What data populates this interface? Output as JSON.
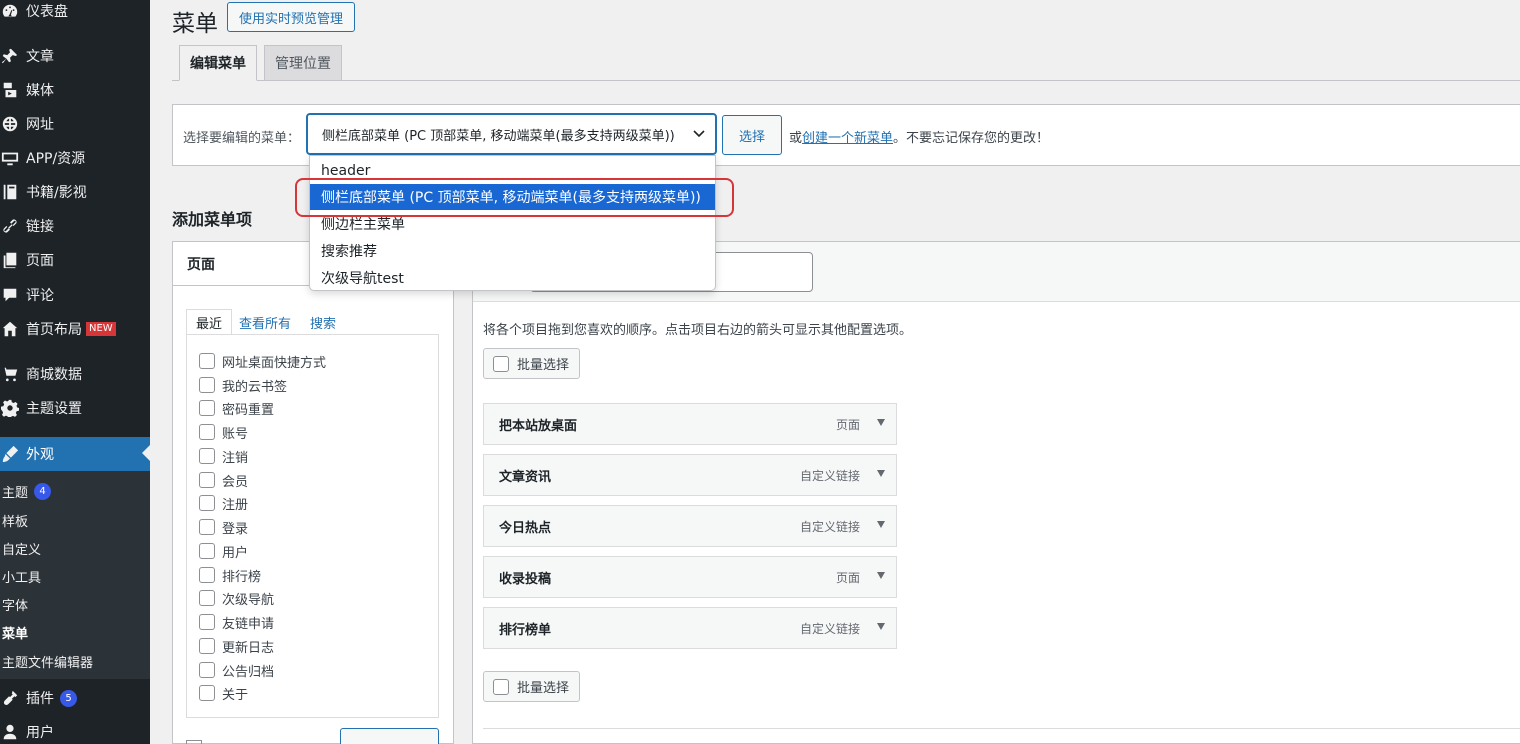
{
  "sidebar": {
    "items": [
      {
        "label": "仪表盘",
        "icon": "dashboard-icon"
      },
      {
        "label": "文章",
        "icon": "pin-icon"
      },
      {
        "label": "媒体",
        "icon": "media-icon"
      },
      {
        "label": "网址",
        "icon": "globe-icon"
      },
      {
        "label": "APP/资源",
        "icon": "monitor-icon"
      },
      {
        "label": "书籍/影视",
        "icon": "book-icon"
      },
      {
        "label": "链接",
        "icon": "link-icon"
      },
      {
        "label": "页面",
        "icon": "page-icon"
      },
      {
        "label": "评论",
        "icon": "comment-icon"
      },
      {
        "label": "首页布局",
        "icon": "home-icon",
        "badge": "NEW"
      },
      {
        "label": "商城数据",
        "icon": "cart-icon"
      },
      {
        "label": "主题设置",
        "icon": "gear-icon"
      },
      {
        "label": "外观",
        "icon": "brush-icon",
        "active": true
      },
      {
        "label": "插件",
        "icon": "plugin-icon",
        "count": "5"
      },
      {
        "label": "用户",
        "icon": "user-icon"
      }
    ],
    "submenu": [
      {
        "label": "主题",
        "count": "4"
      },
      {
        "label": "样板"
      },
      {
        "label": "自定义"
      },
      {
        "label": "小工具"
      },
      {
        "label": "字体"
      },
      {
        "label": "菜单",
        "current": true
      },
      {
        "label": "主题文件编辑器"
      }
    ]
  },
  "header": {
    "title": "菜单",
    "preview_button": "使用实时预览管理"
  },
  "tabs": [
    {
      "label": "编辑菜单",
      "active": true
    },
    {
      "label": "管理位置",
      "active": false
    }
  ],
  "manage": {
    "label": "选择要编辑的菜单：",
    "selected_menu": "侧栏底部菜单 (PC 顶部菜单, 移动端菜单(最多支持两级菜单))",
    "select_button": "选择",
    "text_or": "或",
    "create_link": "创建一个新菜单",
    "text_after": "。不要忘记保存您的更改！"
  },
  "dropdown": {
    "options": [
      "header",
      "侧栏底部菜单 (PC 顶部菜单, 移动端菜单(最多支持两级菜单))",
      "侧边栏主菜单",
      "搜索推荐",
      "次级导航test"
    ],
    "selected_index": 1
  },
  "add_items": {
    "title": "添加菜单项",
    "box_title": "页面",
    "tabs": [
      "最近",
      "查看所有",
      "搜索"
    ],
    "pages": [
      "网址桌面快捷方式",
      "我的云书签",
      "密码重置",
      "账号",
      "注销",
      "会员",
      "注册",
      "登录",
      "用户",
      "排行榜",
      "次级导航",
      "友链申请",
      "更新日志",
      "公告归档",
      "关于"
    ]
  },
  "structure": {
    "instructions": "将各个项目拖到您喜欢的顺序。点击项目右边的箭头可显示其他配置选项。",
    "bulk_select": "批量选择",
    "items": [
      {
        "title": "把本站放桌面",
        "type": "页面"
      },
      {
        "title": "文章资讯",
        "type": "自定义链接"
      },
      {
        "title": "今日热点",
        "type": "自定义链接"
      },
      {
        "title": "收录投稿",
        "type": "页面"
      },
      {
        "title": "排行榜单",
        "type": "自定义链接"
      }
    ]
  },
  "colors": {
    "sidebar_bg": "#1d2327",
    "accent": "#2271b1",
    "dropdown_selected": "#1967d2",
    "highlight_ring": "#d63638"
  }
}
